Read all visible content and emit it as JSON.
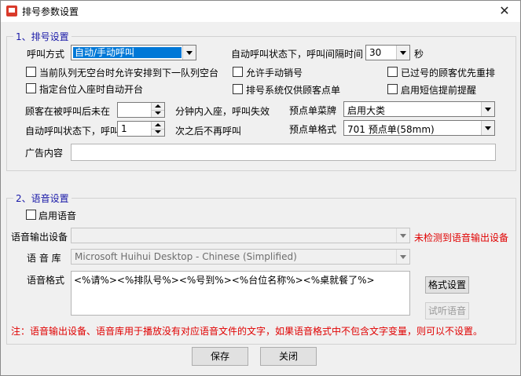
{
  "window": {
    "title": "排号参数设置",
    "close_symbol": "✕"
  },
  "queue_settings": {
    "legend": "1、排号设置",
    "call_mode_label": "呼叫方式",
    "call_mode_value": "自动/手动呼叫",
    "interval_label": "自动呼叫状态下，呼叫间隔时间",
    "interval_value": "30",
    "interval_unit": "秒",
    "checkboxes": [
      {
        "label": "当前队列无空台时允许安排到下一队列空台",
        "checked": false
      },
      {
        "label": "允许手动销号",
        "checked": false
      },
      {
        "label": "已过号的顾客优先重排",
        "checked": false
      },
      {
        "label": "指定台位入座时自动开台",
        "checked": false
      },
      {
        "label": "排号系统仅供顾客点单",
        "checked": false
      },
      {
        "label": "启用短信提前提醒",
        "checked": false
      }
    ],
    "timeout_label": "顾客在被呼叫后未在",
    "timeout_value": "",
    "timeout_suffix": "分钟内入座，呼叫失效",
    "auto_stop_label": "自动呼叫状态下，呼叫",
    "auto_stop_value": "1",
    "auto_stop_suffix": "次之后不再呼叫",
    "preorder_menu_label": "预点单菜牌",
    "preorder_menu_value": "启用大类",
    "preorder_format_label": "预点单格式",
    "preorder_format_value": "701 预点单(58mm)",
    "ad_label": "广告内容",
    "ad_value": ""
  },
  "voice_settings": {
    "legend": "2、语音设置",
    "enable_label": "启用语音",
    "enable_checked": false,
    "device_label": "语音输出设备",
    "device_value": "",
    "device_warning": "未检测到语音输出设备",
    "library_label": "语 音 库",
    "library_value": "Microsoft Huihui Desktop - Chinese (Simplified)",
    "format_label": "语音格式",
    "format_value": "<%请%><%排队号%><%号到%><%台位名称%><%桌就餐了%>",
    "format_button": "格式设置",
    "preview_button": "试听语音"
  },
  "note": "注：语音输出设备、语音库用于播放没有对应语音文件的文字，如果语音格式中不包含文字变量，则可以不设置。",
  "footer": {
    "save_label": "保存",
    "close_label": "关闭"
  }
}
